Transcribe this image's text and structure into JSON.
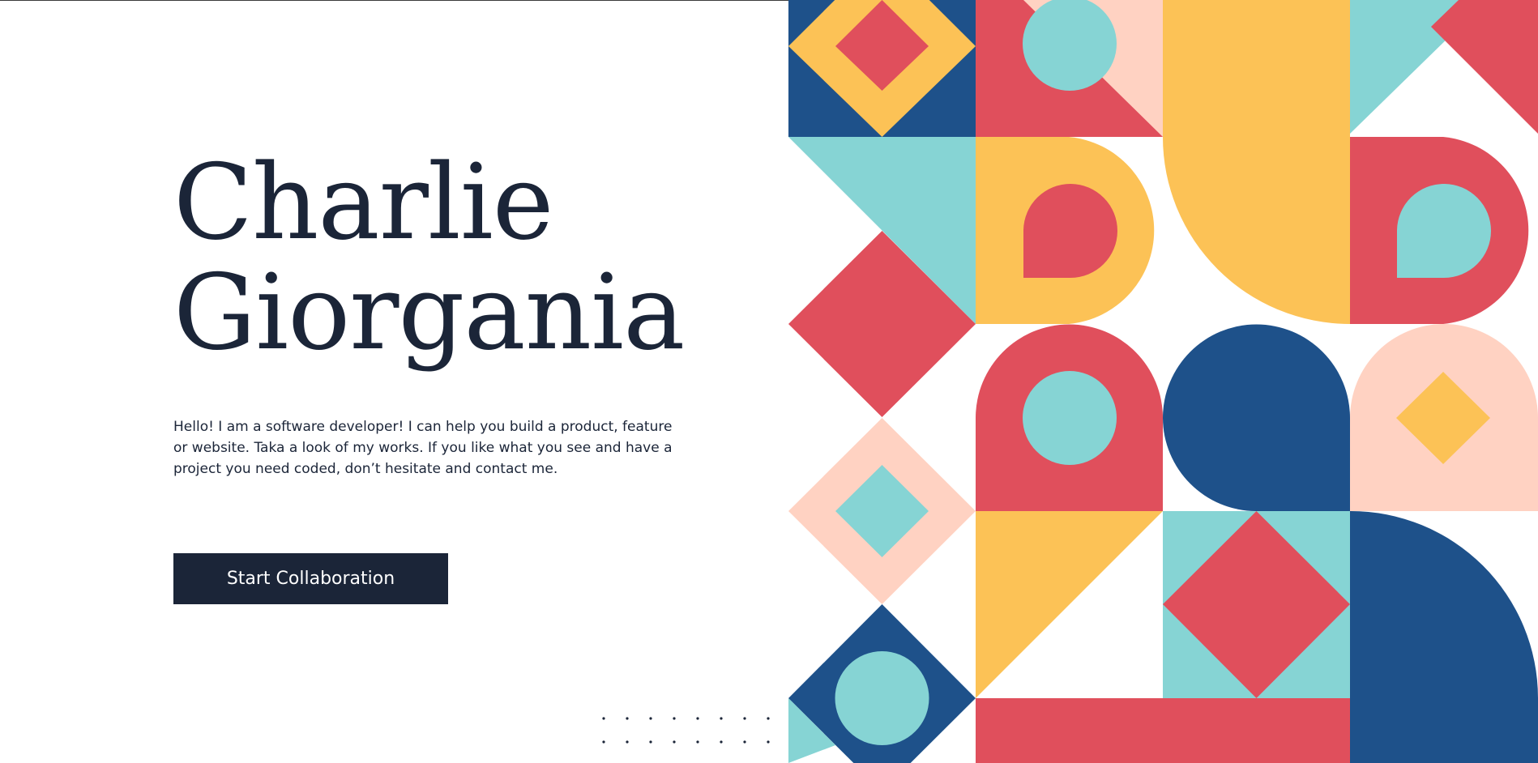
{
  "hero": {
    "name_line1": "Charlie",
    "name_line2": "Giorgania",
    "description": "Hello! I am a software developer! I can help you build a product, feature or website. Taka a look of my works. If you like what you see and have a project you need coded, don’t hesitate and contact me.",
    "cta_label": "Start Collaboration"
  },
  "palette": {
    "navy": "#1b2538",
    "blue": "#1e518a",
    "red": "#e04f5c",
    "yellow": "#fcc256",
    "teal": "#86d4d4",
    "peach": "#ffd2c2",
    "white": "#ffffff"
  }
}
